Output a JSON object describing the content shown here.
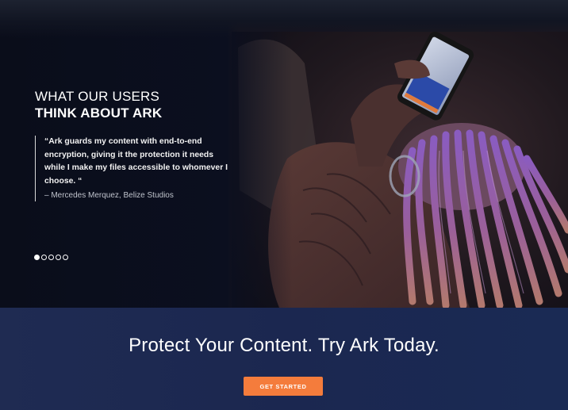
{
  "testimonials": {
    "heading_line1": "WHAT OUR USERS",
    "heading_line2": "THINK ABOUT ARK",
    "quote": "“Ark guards my content with end-to-end encryption, giving it the protection it needs while I make my files accessible to whomever I choose. “",
    "author": "– Mercedes Merquez, Belize Studios",
    "carousel": {
      "total_slides": 5,
      "active_slide": 1
    },
    "image": "person-with-braids-using-phone"
  },
  "cta": {
    "title": "Protect Your Content. Try Ark Today.",
    "button_label": "GET STARTED"
  },
  "colors": {
    "hero_background": "#0b0f1e",
    "cta_background": "#1d2a52",
    "button": "#f47c3c",
    "text": "#ffffff"
  }
}
